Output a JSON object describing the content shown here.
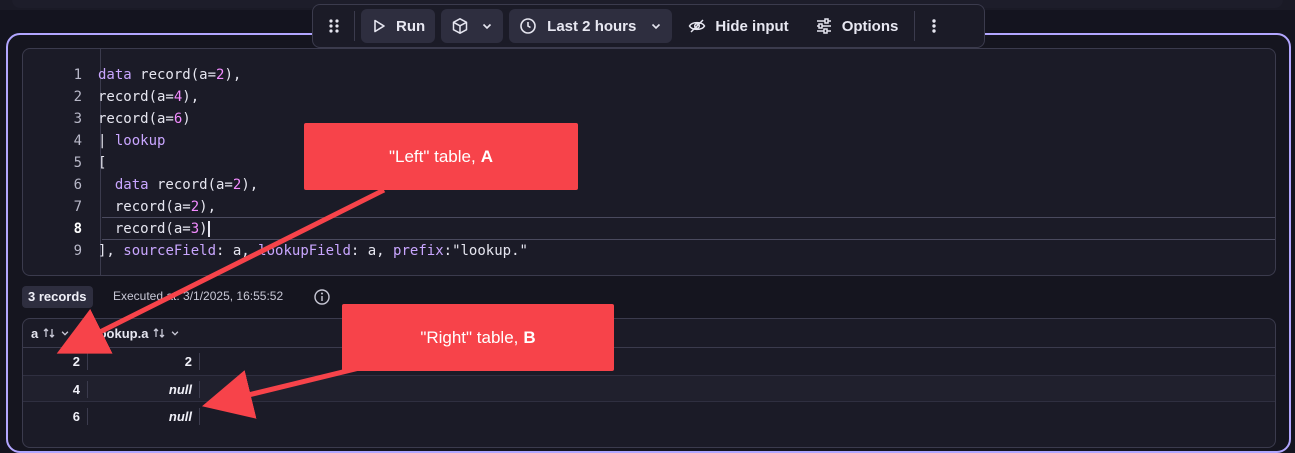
{
  "toolbar": {
    "run_label": "Run",
    "timeframe_label": "Last 2 hours",
    "hide_input_label": "Hide input",
    "options_label": "Options",
    "icons": [
      "drag-handle-icon",
      "play-icon",
      "cube-icon",
      "chevron-down-icon",
      "clock-icon",
      "eye-off-icon",
      "sliders-icon",
      "more-vertical-icon"
    ]
  },
  "editor": {
    "line_numbers": [
      "1",
      "2",
      "3",
      "4",
      "5",
      "6",
      "7",
      "8",
      "9"
    ],
    "active_line": 8
  },
  "status": {
    "records": "3 records",
    "executed": "Executed at: 3/1/2025, 16:55:52"
  },
  "table": {
    "columns": [
      {
        "label": "a"
      },
      {
        "label": "lookup.a"
      }
    ],
    "rows": [
      {
        "a": "2",
        "lookup_a": "2"
      },
      {
        "a": "4",
        "lookup_a": "null"
      },
      {
        "a": "6",
        "lookup_a": "null"
      }
    ]
  },
  "callouts": {
    "left_text": "\"Left\" table,",
    "left_letter": "A",
    "right_text": "\"Right\" table,",
    "right_letter": "B"
  },
  "colors": {
    "accent_border": "#b2a6ff",
    "callout": "#f7434a",
    "keyword": "#c9a6ff",
    "number": "#f38cff"
  }
}
